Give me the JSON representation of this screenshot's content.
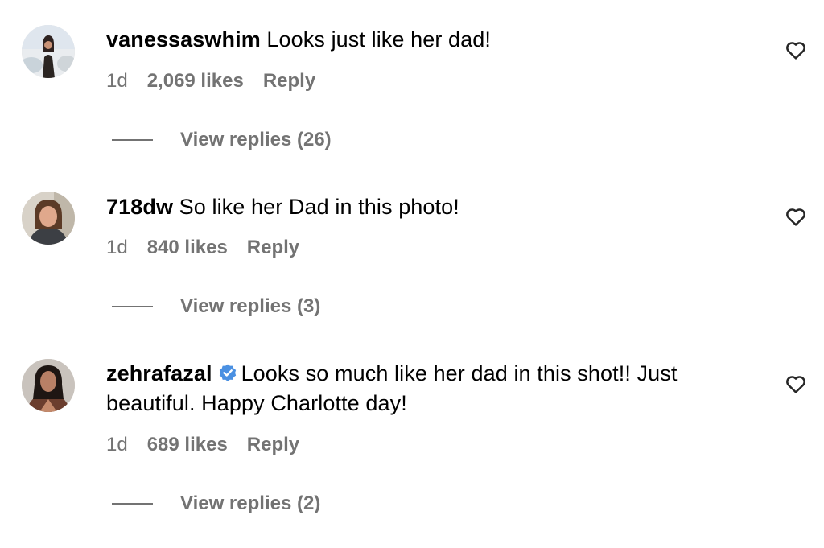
{
  "comments": [
    {
      "username": "vanessaswhim",
      "verified": false,
      "text": "Looks just like her dad!",
      "text_line2": "",
      "age": "1d",
      "likes": "2,069 likes",
      "reply_label": "Reply",
      "view_replies": "View replies (26)"
    },
    {
      "username": "718dw",
      "verified": false,
      "text": "So like her Dad in this photo!",
      "text_line2": "",
      "age": "1d",
      "likes": "840 likes",
      "reply_label": "Reply",
      "view_replies": "View replies (3)"
    },
    {
      "username": "zehrafazal",
      "verified": true,
      "text": "Looks so much like her dad in this shot!! Just",
      "text_line2": "beautiful. Happy Charlotte day!",
      "age": "1d",
      "likes": "689 likes",
      "reply_label": "Reply",
      "view_replies": "View replies (2)"
    }
  ],
  "icons": {
    "like": "heart-outline-icon",
    "verified": "verified-badge-icon"
  },
  "colors": {
    "text": "#000000",
    "muted": "#737373",
    "verified": "#4a90e2",
    "background": "#ffffff"
  }
}
